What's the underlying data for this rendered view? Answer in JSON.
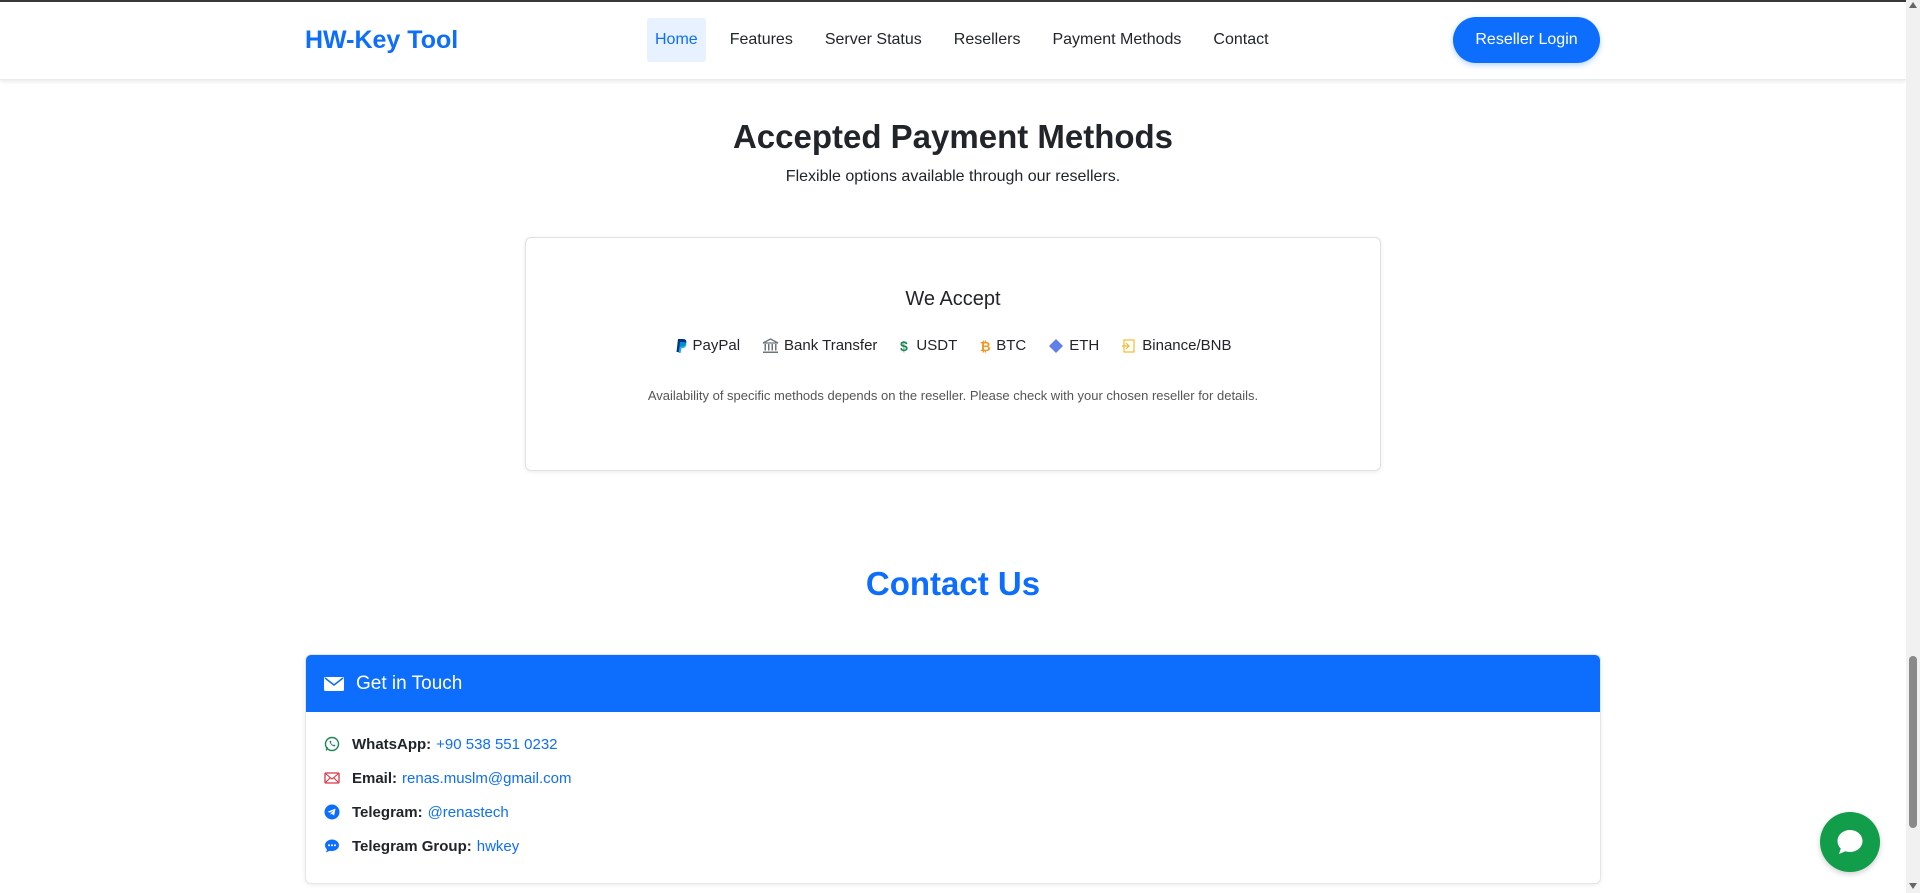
{
  "navbar": {
    "brand": "HW-Key Tool",
    "items": [
      {
        "label": "Home",
        "active": true
      },
      {
        "label": "Features"
      },
      {
        "label": "Server Status"
      },
      {
        "label": "Resellers"
      },
      {
        "label": "Payment Methods"
      },
      {
        "label": "Contact"
      }
    ],
    "login_label": "Reseller Login"
  },
  "payment": {
    "title": "Accepted Payment Methods",
    "subtitle": "Flexible options available through our resellers.",
    "card_title": "We Accept",
    "methods": [
      {
        "label": "PayPal",
        "icon": "paypal-icon",
        "color": "#003087"
      },
      {
        "label": "Bank Transfer",
        "icon": "bank-icon",
        "color": "#6c757d"
      },
      {
        "label": "USDT",
        "icon": "dollar-icon",
        "color": "#198754"
      },
      {
        "label": "BTC",
        "icon": "bitcoin-icon",
        "color": "#f7931a"
      },
      {
        "label": "ETH",
        "icon": "ethereum-icon",
        "color": "#627eea"
      },
      {
        "label": "Binance/BNB",
        "icon": "binance-icon",
        "color": "#f3ba2f"
      }
    ],
    "note": "Availability of specific methods depends on the reseller. Please check with your chosen reseller for details."
  },
  "contact": {
    "title": "Contact Us",
    "card_title": "Get in Touch",
    "rows": [
      {
        "label": "WhatsApp:",
        "value": "+90 538 551 0232",
        "icon": "whatsapp-icon"
      },
      {
        "label": "Email:",
        "value": "renas.muslm@gmail.com",
        "icon": "envelope-icon"
      },
      {
        "label": "Telegram:",
        "value": "@renastech",
        "icon": "telegram-icon"
      },
      {
        "label": "Telegram Group:",
        "value": "hwkey",
        "icon": "chat-dots-icon"
      }
    ]
  },
  "colors": {
    "primary": "#0d6efd",
    "whatsapp": "#129d4a",
    "email_icon": "#dc3545"
  }
}
